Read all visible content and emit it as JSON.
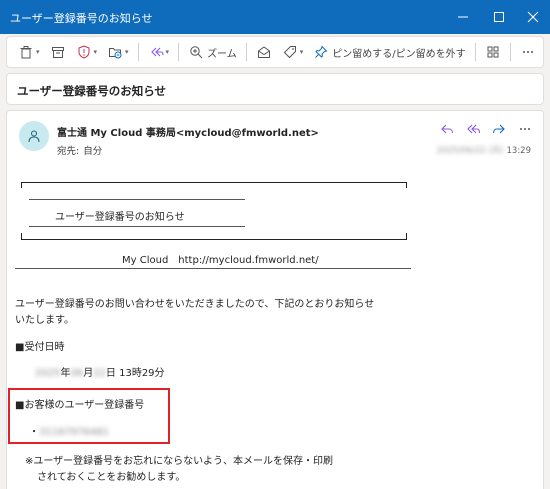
{
  "window": {
    "title": "ユーザー登録番号のお知らせ",
    "controls": [
      "minimize",
      "maximize",
      "close"
    ]
  },
  "toolbar": {
    "zoom_label": "ズーム",
    "pin_label": "ピン留めする/ピン留めを外す"
  },
  "subject": "ユーザー登録番号のお知らせ",
  "message": {
    "sender": "富士通 My Cloud 事務局<mycloud@fmworld.net>",
    "to_label": "宛先:",
    "to_value": "自分",
    "date_blurred": "2025/06/22 (月)",
    "time": "13:29"
  },
  "body": {
    "banner_title": "ユーザー登録番号のお知らせ",
    "site_line": "My Cloud　http://mycloud.fmworld.net/",
    "intro_line1": "ユーザー登録番号のお問い合わせをいただきましたので、下記のとおりお知らせ",
    "intro_line2": "いたします。",
    "received_heading": "■受付日時",
    "received_year_blur": "2025",
    "received_year_label": "年",
    "received_month_blur": "06",
    "received_month_label": "月",
    "received_day_blur": "22",
    "received_day_time": "日 13時29分",
    "reg_heading": "■お客様のユーザー登録番号",
    "reg_bullet": "・",
    "reg_number_blur": "31167976481",
    "note_line1": "※ユーザー登録番号をお忘れにならないよう、本メールを保存・印刷",
    "note_line2": "されておくことをお勧めします。"
  },
  "colors": {
    "title_bar": "#0f6cbd",
    "highlight_box": "#e0202a",
    "avatar_bg": "#c7e9ef",
    "accent_icon": "#8a5bd6"
  }
}
